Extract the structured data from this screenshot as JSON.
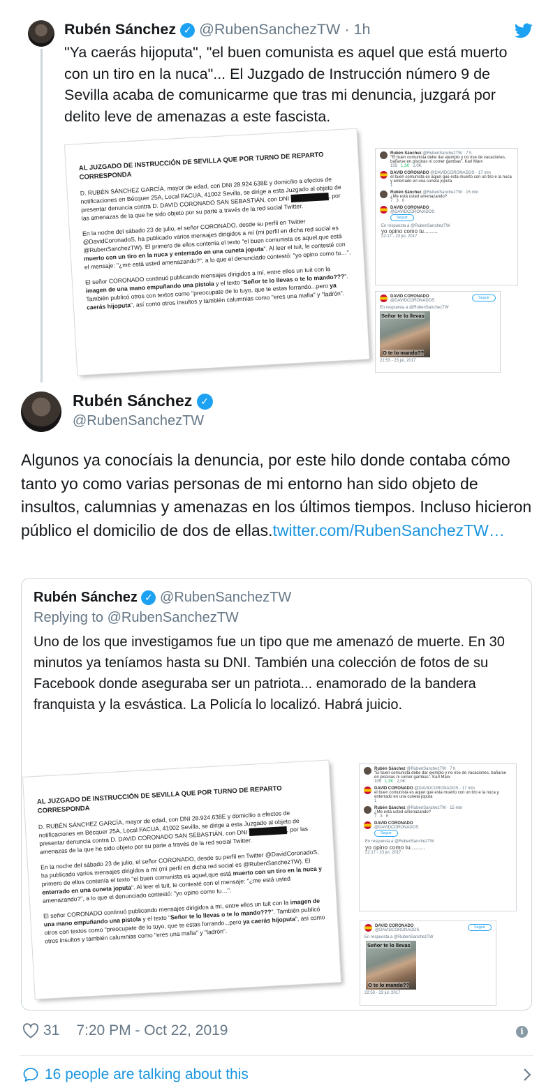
{
  "parent_tweet": {
    "name": "Rubén Sánchez",
    "handle": "@RubenSanchezTW",
    "separator": "·",
    "time": "1h",
    "text": "\"Ya caerás hijoputa\", \"el buen comunista es aquel que está muerto con un tiro en la nuca\"... El Juzgado de Instrucción número 9 de Sevilla acaba de comunicarme que tras mi denuncia, juzgará por delito leve de amenazas a este fascista."
  },
  "document": {
    "heading": "AL JUZGADO DE INSTRUCCIÓN DE SEVILLA QUE POR TURNO DE REPARTO CORRESPONDA",
    "p1": "D. RUBÉN SÁNCHEZ GARCÍA, mayor de edad, con DNI 28.924.638E y domicilio a efectos de notificaciones en Bécquer 25A, Local FACUA, 41002 Sevilla, se dirige a esta Juzgado al objeto de presentar denuncia contra D. DAVID CORONADO SAN SEBASTIÁN, con DNI",
    "p1b": ", por las amenazas de la que he sido objeto por su parte a través de la red social Twitter.",
    "p2a": "En la noche del sábado 23 de julio, el señor CORONADO, desde su perfil en Twitter @DavidCoronadoS, ha publicado varios mensajes dirigidos a mí (mi perfil en dicha red social es @RubenSanchezTW). El primero de ellos contenía el texto \"el buen comunista es aquel,que está ",
    "p2bold": "muerto con un tiro en la nuca y enterrado en una cuneta joputa",
    "p2c": "\". Al leer el tuit, le contesté con el mensaje: \"¿me está usted amenazando?\", a lo que el denunciado contestó: \"yo opino como tu…\".",
    "p3a": "El señor CORONADO continuó publicando mensajes dirigidos a mí, entre ellos un tuit con la ",
    "p3bold": "imagen de una mano empuñando una pistola",
    "p3b": " y el texto \"",
    "p3bold2": "Señor te lo llevas o te lo mando???",
    "p3c": "\". También publicó otros con textos como \"preocupate de lo tuyo, que te estas forrando...pero ",
    "p3bold3": "ya caerás hijoputa",
    "p3d": "\", así como otros insultos y también calumnias como \"eres una mafia\" y \"ladrón\"."
  },
  "screenshot_thread": {
    "t1_name": "Rubén Sánchez",
    "t1_handle": "@RubenSanchezTW · 7 h",
    "t1_text": "\"El buen comunista debe dar ejemplo y no irse de vacaciones, bañarse en piscinas ni comer gambas\". Karl Marx",
    "t1_stats": [
      "105",
      "1,3K",
      "2,0K"
    ],
    "t2_name": "DAVID CORONADO",
    "t2_handle": "@DAVIDCORONADOS · 17 min",
    "t2_text": "el buen comunista es aquel que esta muerto con un tiro e la nuca y enterrado en una cuneta joputa",
    "t2_stats": [
      "1",
      "",
      ""
    ],
    "t3_name": "Rubén Sánchez",
    "t3_handle": "@RubenSanchezTW · 15 min",
    "t3_text": "¿Me está usted amenazando?",
    "t3_stats": [
      "7",
      "",
      "3",
      "6"
    ],
    "t4_name": "DAVID CORONADO",
    "t4_handle": "@DAVIDCORONADOS",
    "follow": "Seguir",
    "reply_to": "En respuesta a @RubenSanchezTW",
    "reply_text": "yo opino como tu.........",
    "reply_time": "22:17 - 23 jul. 2017"
  },
  "screenshot_pistol": {
    "name": "DAVID CORONADO",
    "handle": "@DAVIDCORONADOS",
    "follow": "Seguir",
    "reply_to": "En respuesta a @RubenSanchezTW",
    "caption_top": "Señor te lo llevas",
    "caption_bottom": "O te lo mando??",
    "time": "22:53 - 23 jul. 2017"
  },
  "main_tweet": {
    "name": "Rubén Sánchez",
    "handle": "@RubenSanchezTW",
    "text": "Algunos ya conocíais la denuncia, por este hilo donde contaba cómo tanto yo como varias personas de mi entorno han sido objeto de insultos, calumnias y amenazas en los últimos tiempos. Incluso hicieron público el domicilio de dos de ellas.",
    "link": "twitter.com/RubenSanchezTW…",
    "likes": "31",
    "timestamp": "7:20 PM - Oct 22, 2019",
    "conversation": "16 people are talking about this"
  },
  "quoted_tweet": {
    "name": "Rubén Sánchez",
    "handle": "@RubenSanchezTW",
    "replying_prefix": "Replying to ",
    "replying_handle": "@RubenSanchezTW",
    "text": "Uno de los que investigamos fue un tipo que me amenazó de muerte. En 30 minutos ya teníamos hasta su DNI. También una colección de fotos de su Facebook donde aseguraba ser un patriota... enamorado de la bandera franquista y la esvástica. La Policía lo localizó. Habrá juicio."
  },
  "icons": [
    "twitter-bird-icon",
    "verified-badge-icon",
    "heart-icon",
    "info-icon",
    "speech-bubble-icon",
    "chevron-right-icon"
  ],
  "colors": {
    "link": "#1b95e0",
    "verified": "#1da1f2",
    "muted": "#657786",
    "border": "#ccd6dd"
  }
}
